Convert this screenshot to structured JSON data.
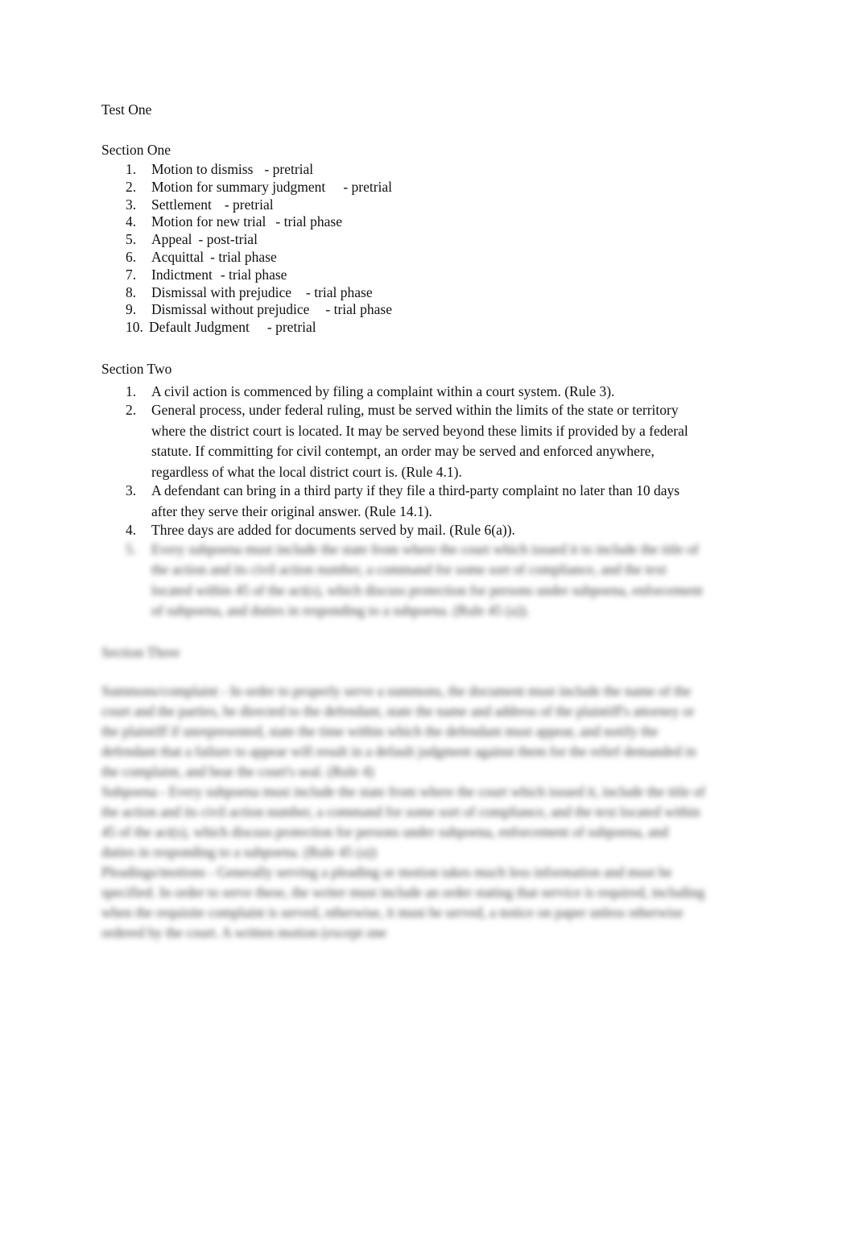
{
  "document": {
    "title": "Test One",
    "section_one": {
      "heading": "Section One",
      "items": [
        {
          "num": "1.",
          "term": "Motion to dismiss",
          "phase": "- pretrial"
        },
        {
          "num": "2.",
          "term": "Motion for summary judgment",
          "phase": "- pretrial"
        },
        {
          "num": "3.",
          "term": "Settlement",
          "phase": "- pretrial"
        },
        {
          "num": "4.",
          "term": "Motion for new trial",
          "phase": "- trial phase"
        },
        {
          "num": "5.",
          "term": "Appeal",
          "phase": "- post-trial"
        },
        {
          "num": "6.",
          "term": "Acquittal",
          "phase": "- trial phase"
        },
        {
          "num": "7.",
          "term": "Indictment",
          "phase": "- trial phase"
        },
        {
          "num": "8.",
          "term": "Dismissal with prejudice",
          "phase": "- trial phase"
        },
        {
          "num": "9.",
          "term": "Dismissal without prejudice",
          "phase": "- trial phase"
        },
        {
          "num": "10.",
          "term": "Default Judgment",
          "phase": "- pretrial"
        }
      ]
    },
    "section_two": {
      "heading": "Section Two",
      "items": [
        {
          "num": "1.",
          "text": "A civil action is commenced by filing a complaint within a court system. (Rule 3)."
        },
        {
          "num": "2.",
          "text": "General process, under federal ruling, must be served within the limits of the state or territory where the district court is located. It may be served beyond these limits if provided by a federal statute. If committing for civil contempt, an order may be served and enforced anywhere, regardless of what the local district court is. (Rule 4.1)."
        },
        {
          "num": "3.",
          "text": "A defendant can bring in a third party if they file a third-party complaint no later than 10 days after they serve their original answer. (Rule 14.1)."
        },
        {
          "num": "4.",
          "text": "Three days are added for documents served by mail. (Rule 6(a))."
        },
        {
          "num": "5.",
          "text": "Every subpoena must include the state from where the court which issued it to include the title of the action and its civil action number, a command for some sort of compliance, and the text located within 45 of the act(s), which discuss protection for persons under subpoena, enforcement of subpoena, and duties in responding to a subpoena. (Rule 45 (a))."
        }
      ]
    },
    "section_three": {
      "heading": "Section Three",
      "paragraphs": [
        "Summons/complaint - In order to properly serve a summons, the document must include the name of the court and the parties, be directed to the defendant, state the name and address of the plaintiff's attorney or the plaintiff if unrepresented, state the time within which the defendant must appear, and notify the defendant that a failure to appear will result in a default judgment against them for the relief demanded in the complaint, and bear the court's seal. (Rule 4)",
        "Subpoena - Every subpoena must include the state from where the court which issued it, include the title of the action and its civil action number, a command for some sort of compliance, and the text located within 45 of the act(s), which discuss protection for persons under subpoena, enforcement of subpoena, and duties in responding to a subpoena. (Rule 45 (a))",
        "Pleadings/motions - Generally serving a pleading or motion takes much less information and must be specified. In order to serve these, the writer must include an order stating that service is required, including when the requisite complaint is served, otherwise, it must be served, a notice on paper unless otherwise ordered by the court. A written motion (except one"
      ]
    }
  }
}
